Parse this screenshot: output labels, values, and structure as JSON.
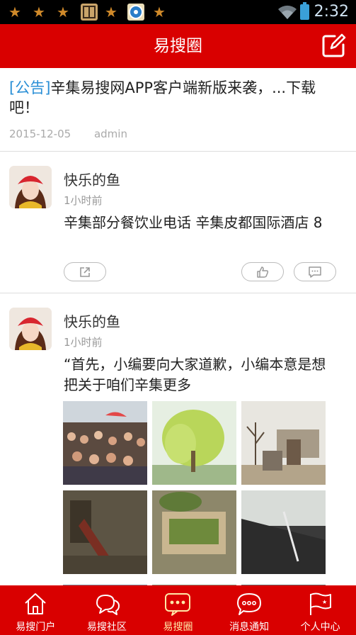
{
  "status_bar": {
    "time": "2:32",
    "notification_icons": [
      "star-icon",
      "star-icon",
      "star-icon",
      "app-icon",
      "star-icon",
      "steering-wheel-icon",
      "star-icon"
    ],
    "wifi": "wifi-icon",
    "battery": "battery-icon"
  },
  "header": {
    "title": "易搜圈",
    "compose_icon": "compose-icon"
  },
  "notice": {
    "tag": "[公告]",
    "title": "辛集易搜网APP客户端新版来袭，...下载吧！",
    "date": "2015-12-05",
    "author": "admin"
  },
  "posts": [
    {
      "author": "快乐的鱼",
      "time": "1小时前",
      "text": "辛集部分餐饮业电话  辛集皮都国际酒店        8"
    },
    {
      "author": "快乐的鱼",
      "time": "1小时前",
      "text": "“首先，小编要向大家道歉，小编本意是想把关于咱们辛集更多"
    }
  ],
  "tabs": [
    {
      "label": "易搜门户",
      "icon": "home-icon"
    },
    {
      "label": "易搜社区",
      "icon": "chat-bubbles-icon"
    },
    {
      "label": "易搜圈",
      "icon": "circle-chat-icon",
      "active": true
    },
    {
      "label": "消息通知",
      "icon": "message-icon"
    },
    {
      "label": "个人中心",
      "icon": "flag-icon"
    }
  ],
  "colors": {
    "brand_red": "#d90000",
    "link_blue": "#2a8fd6",
    "active_tab_label": "#ffe9a8"
  }
}
